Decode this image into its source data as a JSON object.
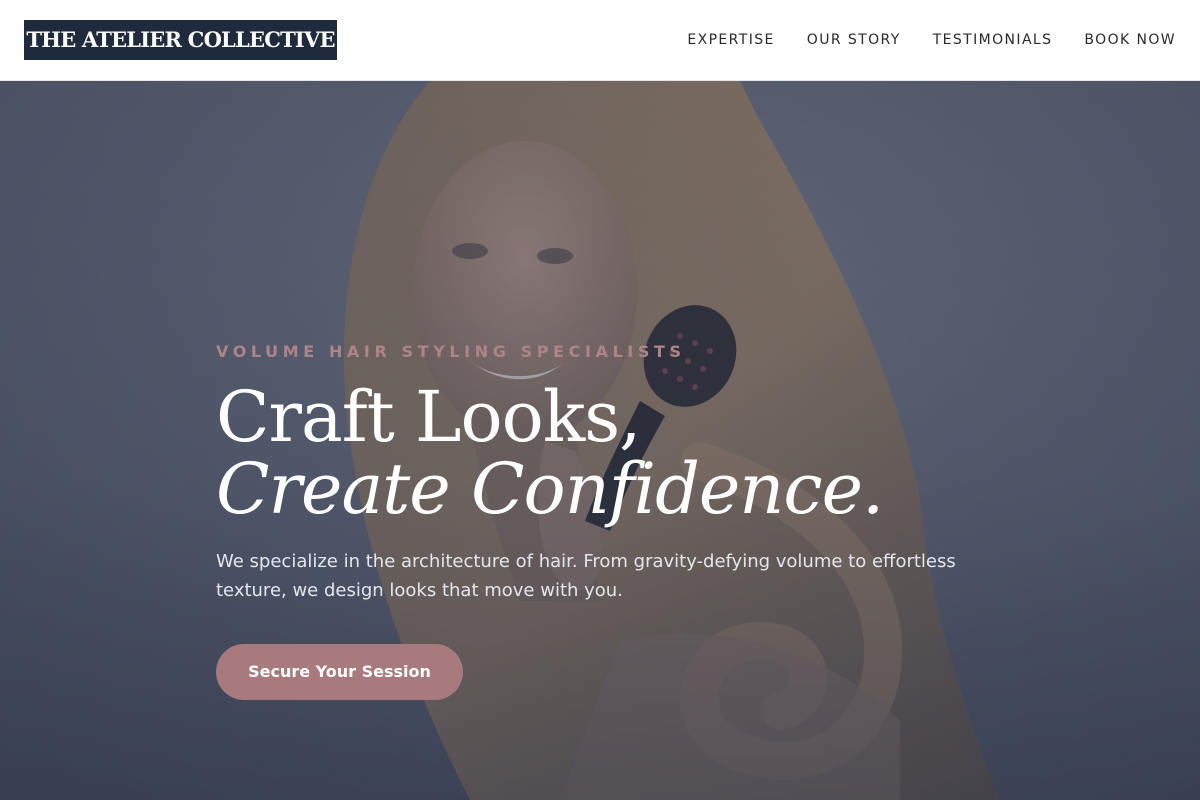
{
  "header": {
    "logo_text": "THE ATELIER COLLECTIVE",
    "nav": [
      {
        "label": "EXPERTISE"
      },
      {
        "label": "OUR STORY"
      },
      {
        "label": "TESTIMONIALS"
      },
      {
        "label": "BOOK NOW"
      }
    ]
  },
  "hero": {
    "eyebrow": "VOLUME HAIR STYLING SPECIALISTS",
    "headline_line1": "Craft Looks,",
    "headline_line2": "Create Confidence.",
    "lead": "We specialize in the architecture of hair. From gravity-defying volume to effortless texture, we design looks that move with you.",
    "cta_label": "Secure Your Session"
  },
  "colors": {
    "logo_bg": "#1f2a3d",
    "accent": "#a87a7d",
    "eyebrow": "#b08387",
    "hero_overlay": "#4a5266"
  }
}
